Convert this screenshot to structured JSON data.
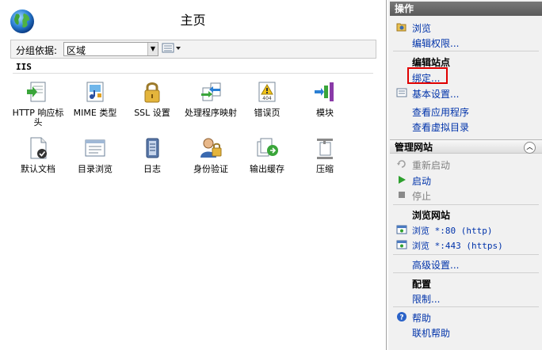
{
  "main": {
    "title": "主页",
    "filter": {
      "label": "分组依据:",
      "value": "区域"
    },
    "group": "IIS",
    "features": [
      {
        "label": "HTTP 响应标头",
        "icon": "http-response-headers-icon"
      },
      {
        "label": "MIME 类型",
        "icon": "mime-types-icon"
      },
      {
        "label": "SSL 设置",
        "icon": "ssl-lock-icon"
      },
      {
        "label": "处理程序映射",
        "icon": "handler-mappings-icon"
      },
      {
        "label": "错误页",
        "icon": "error-page-404-icon"
      },
      {
        "label": "模块",
        "icon": "modules-icon"
      },
      {
        "label": "默认文档",
        "icon": "default-document-icon"
      },
      {
        "label": "目录浏览",
        "icon": "directory-browsing-icon"
      },
      {
        "label": "日志",
        "icon": "logging-icon"
      },
      {
        "label": "身份验证",
        "icon": "authentication-icon"
      },
      {
        "label": "输出缓存",
        "icon": "output-caching-icon"
      },
      {
        "label": "压缩",
        "icon": "compression-icon"
      }
    ]
  },
  "actions": {
    "header": "操作",
    "browse": "浏览",
    "edit_permissions": "编辑权限...",
    "edit_site": "编辑站点",
    "bindings": "绑定...",
    "basic_settings": "基本设置...",
    "view_apps": "查看应用程序",
    "view_vdirs": "查看虚拟目录",
    "manage_site": "管理网站",
    "restart": "重新启动",
    "start": "启动",
    "stop": "停止",
    "browse_site": "浏览网站",
    "browse_80": "浏览 *:80 (http)",
    "browse_443": "浏览 *:443 (https)",
    "advanced": "高级设置...",
    "config": "配置",
    "limits": "限制...",
    "help": "帮助",
    "online_help": "联机帮助"
  },
  "colors": {
    "link": "#0033aa",
    "highlight": "#e00000",
    "header_bg": "#666666"
  }
}
